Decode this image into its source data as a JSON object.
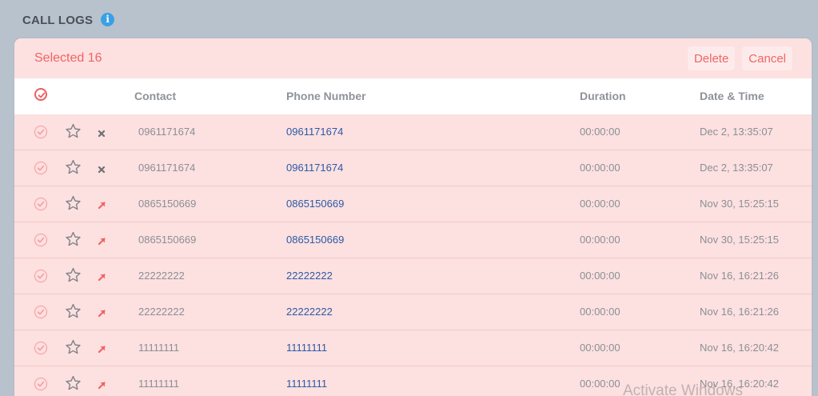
{
  "page": {
    "title": "CALL LOGS",
    "info_icon": "info-icon"
  },
  "selection_bar": {
    "selected_label": "Selected 16",
    "delete_label": "Delete",
    "cancel_label": "Cancel"
  },
  "table": {
    "columns": [
      "Contact",
      "Phone Number",
      "Duration",
      "Date & Time"
    ],
    "rows": [
      {
        "contact": "0961171674",
        "phone": "0961171674",
        "duration": "00:00:00",
        "datetime": "Dec 2, 13:35:07",
        "status": "missed"
      },
      {
        "contact": "0961171674",
        "phone": "0961171674",
        "duration": "00:00:00",
        "datetime": "Dec 2, 13:35:07",
        "status": "missed"
      },
      {
        "contact": "0865150669",
        "phone": "0865150669",
        "duration": "00:00:00",
        "datetime": "Nov 30, 15:25:15",
        "status": "outgoing"
      },
      {
        "contact": "0865150669",
        "phone": "0865150669",
        "duration": "00:00:00",
        "datetime": "Nov 30, 15:25:15",
        "status": "outgoing"
      },
      {
        "contact": "22222222",
        "phone": "22222222",
        "duration": "00:00:00",
        "datetime": "Nov 16, 16:21:26",
        "status": "outgoing"
      },
      {
        "contact": "22222222",
        "phone": "22222222",
        "duration": "00:00:00",
        "datetime": "Nov 16, 16:21:26",
        "status": "outgoing"
      },
      {
        "contact": "11111111",
        "phone": "11111111",
        "duration": "00:00:00",
        "datetime": "Nov 16, 16:20:42",
        "status": "outgoing"
      },
      {
        "contact": "11111111",
        "phone": "11111111",
        "duration": "00:00:00",
        "datetime": "Nov 16, 16:20:42",
        "status": "outgoing"
      }
    ]
  },
  "watermark": "Activate Windows",
  "colors": {
    "accent": "#f06464",
    "selected_row_bg": "#fde0e0",
    "phone_link": "#2a5aa6",
    "page_bg": "#b8c2cc"
  }
}
